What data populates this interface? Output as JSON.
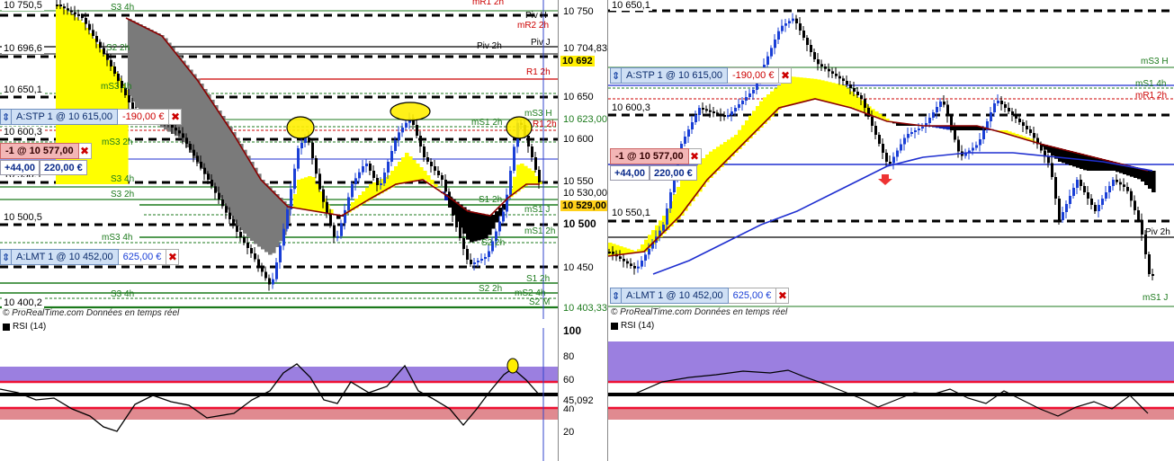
{
  "left": {
    "price_labels": {
      "p10750_5": "10 750,5",
      "p10696_6": "10 696,6",
      "p10650_1": "10 650,1",
      "p10600_3": "10 600,3",
      "p10550_1": "10 550,1",
      "p10500_5": "10 500,5",
      "p10400_2": "10 400,2"
    },
    "axis": {
      "t10750": "10 750",
      "t10704": "10 704,83",
      "t10692": "10 692",
      "t10650": "10 650",
      "t10623": "10 623,00",
      "t10600": "10 600",
      "t10550": "10 550",
      "t10530": "10 530,00",
      "t10529": "10 529,00",
      "t10500": "10 500",
      "t10450": "10 450",
      "t10403": "10 403,33"
    },
    "levels": {
      "s3h": "S3 4h",
      "mr1": "mR1 2h",
      "pivh": "Piv H",
      "mr2": "mR2 2h",
      "s22h": "S2 2h",
      "piv2h": "Piv 2h",
      "pivj": "Piv J",
      "r12h": "R1 2h",
      "ms34h": "mS3 4h",
      "ms3h": "mS3 H",
      "ms12h": "mS1 2h",
      "r12h_b": "R1 2h",
      "ms32h": "mS3 2h",
      "s34h": "S3 4h",
      "s32h": "S3 2h",
      "s12h_top": "S1 2h",
      "ms1j": "mS1 J",
      "ms12h_b": "mS1 2h",
      "s22h_b": "S2 2h",
      "ms34h_b": "mS3 4h",
      "s12h": "S1 2h",
      "s22h_c": "S2 2h",
      "ms24h": "mS2 4h",
      "s34h_b": "S3 4h",
      "s2m": "S2 M"
    },
    "orders": {
      "stp": {
        "label": "A:STP  1 @ 10 615,00",
        "value": "-190,00 €"
      },
      "pos": {
        "label": "-1 @ 10 577,00",
        "pts": "+44,00",
        "eur": "220,00 €"
      },
      "lmt": {
        "label": "A:LMT  1 @ 10 452,00",
        "value": "625,00 €"
      }
    },
    "footer": "© ProRealTime.com  Données en temps réel",
    "rsi": {
      "title": "RSI (14)",
      "ticks": {
        "t100": "100",
        "t80": "80",
        "t60": "60",
        "t40": "40",
        "t20": "20"
      },
      "value": "45,092"
    }
  },
  "right": {
    "price_labels": {
      "p10650_1": "10 650,1",
      "p10600_3": "10 600,3",
      "p10550_1": "10 550,1"
    },
    "levels": {
      "ms3h": "mS3 H",
      "ms14h": "mS1 4h",
      "mr12h": "mR1 2h",
      "piv2h": "Piv 2h",
      "ms1j": "mS1 J"
    },
    "orders": {
      "stp": {
        "label": "A:STP  1 @ 10 615,00",
        "value": "-190,00 €"
      },
      "pos": {
        "label": "-1 @ 10 577,00",
        "pts": "+44,00",
        "eur": "220,00 €"
      },
      "lmt": {
        "label": "A:LMT  1 @ 10 452,00",
        "value": "625,00 €"
      }
    },
    "footer": "© ProRealTime.com  Données en temps réel",
    "rsi": {
      "title": "RSI (14)"
    }
  },
  "colors": {
    "candle_up": "#1a3fd6",
    "candle_down": "#000000",
    "ema_fill_up": "#ffff00",
    "ema_fill_down": "#0a1fb0",
    "ema_slow": "#8b0000",
    "ema_long": "#1f2fd0",
    "overbought_band": "#9b7fe0",
    "oversold_band": "#e08a90",
    "line_red": "#ee1133",
    "level_green": "#1c7a1c",
    "highlight_yellow": "#ffee00"
  }
}
